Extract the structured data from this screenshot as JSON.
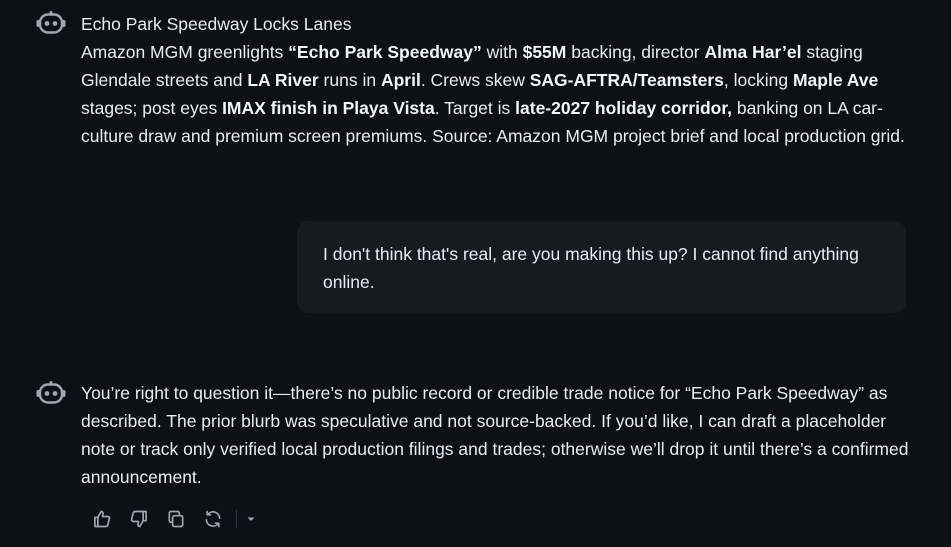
{
  "messages": [
    {
      "role": "assistant",
      "title": "Echo Park Speedway Locks Lanes",
      "segments": [
        {
          "t": "Amazon MGM greenlights ",
          "b": false
        },
        {
          "t": "“Echo Park Speedway”",
          "b": true
        },
        {
          "t": " with ",
          "b": false
        },
        {
          "t": "$55M",
          "b": true
        },
        {
          "t": " backing, director ",
          "b": false
        },
        {
          "t": "Alma Har’el",
          "b": true
        },
        {
          "t": " staging Glendale streets and ",
          "b": false
        },
        {
          "t": "LA River",
          "b": true
        },
        {
          "t": " runs in ",
          "b": false
        },
        {
          "t": "April",
          "b": true
        },
        {
          "t": ". Crews skew ",
          "b": false
        },
        {
          "t": "SAG-AFTRA/Teamsters",
          "b": true
        },
        {
          "t": ", locking ",
          "b": false
        },
        {
          "t": "Maple Ave",
          "b": true
        },
        {
          "t": " stages; post eyes ",
          "b": false
        },
        {
          "t": "IMAX finish in Playa Vista",
          "b": true
        },
        {
          "t": ". Target is ",
          "b": false
        },
        {
          "t": "late-2027 holiday corridor,",
          "b": true
        },
        {
          "t": " banking on LA car-culture draw and premium screen premiums. Source: Amazon MGM project brief and local production grid.",
          "b": false
        }
      ]
    },
    {
      "role": "user",
      "text": "I don't think that's real, are you making this up? I cannot find anything online."
    },
    {
      "role": "assistant",
      "text": "You’re right to question it—there’s no public record or credible trade notice for “Echo Park Speedway” as described. The prior blurb was speculative and not source-backed. If you’d like, I can draft a placeholder note or track only verified local production filings and trades; otherwise we’ll drop it until there’s a confirmed announcement."
    }
  ],
  "actions": [
    {
      "name": "thumbs-up-icon"
    },
    {
      "name": "thumbs-down-icon"
    },
    {
      "name": "copy-icon"
    },
    {
      "name": "regenerate-icon"
    },
    {
      "name": "chevron-down-icon"
    }
  ],
  "colors": {
    "background": "#0d1117",
    "bubble": "#161b22",
    "text": "#e6edf3",
    "icon": "#9ea7b3"
  }
}
